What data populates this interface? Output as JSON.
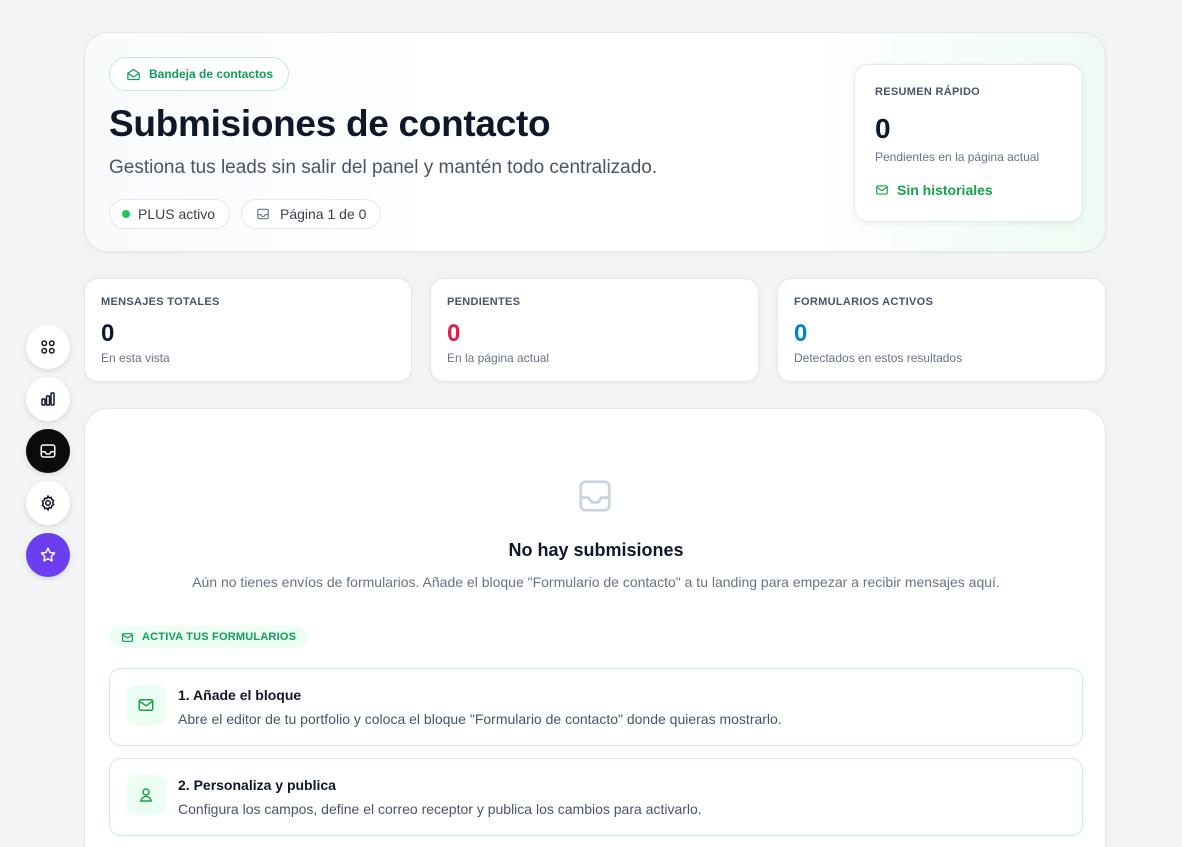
{
  "rail": {
    "items": [
      {
        "icon": "grid-icon"
      },
      {
        "icon": "bar-chart-icon"
      },
      {
        "icon": "inbox-icon",
        "active": true
      },
      {
        "icon": "gear-icon"
      },
      {
        "icon": "star-icon"
      }
    ]
  },
  "hero": {
    "badge": "Bandeja de contactos",
    "title": "Submisiones de contacto",
    "subtitle": "Gestiona tus leads sin salir del panel y mantén todo centralizado.",
    "plan_pill": "PLUS activo",
    "page_pill": "Página 1 de 0"
  },
  "quick_summary": {
    "label": "RESUMEN RÁPIDO",
    "value": "0",
    "note": "Pendientes en la página actual",
    "link": "Sin historiales"
  },
  "stats": [
    {
      "label": "MENSAJES TOTALES",
      "value": "0",
      "note": "En esta vista",
      "color": "#0f172a"
    },
    {
      "label": "PENDIENTES",
      "value": "0",
      "note": "En la página actual",
      "color": "#e11d48"
    },
    {
      "label": "FORMULARIOS ACTIVOS",
      "value": "0",
      "note": "Detectados en estos resultados",
      "color": "#0284c7"
    }
  ],
  "empty_state": {
    "icon": "inbox-icon",
    "title": "No hay submisiones",
    "description": "Aún no tienes envíos de formularios. Añade el bloque \"Formulario de contacto\" a tu landing para empezar a recibir mensajes aquí."
  },
  "activate": {
    "label": "ACTIVA TUS FORMULARIOS"
  },
  "steps": [
    {
      "icon": "mail-icon",
      "title": "1. Añade el bloque",
      "description": "Abre el editor de tu portfolio y coloca el bloque \"Formulario de contacto\" donde quieras mostrarlo."
    },
    {
      "icon": "user-icon",
      "title": "2. Personaliza y publica",
      "description": "Configura los campos, define el correo receptor y publica los cambios para activarlo."
    }
  ],
  "colors": {
    "accent_green": "#16a34a",
    "pending_red": "#e11d48",
    "forms_blue": "#0284c7",
    "rail_active": "#0b0b0c",
    "rail_premium": "#6d3df0"
  }
}
